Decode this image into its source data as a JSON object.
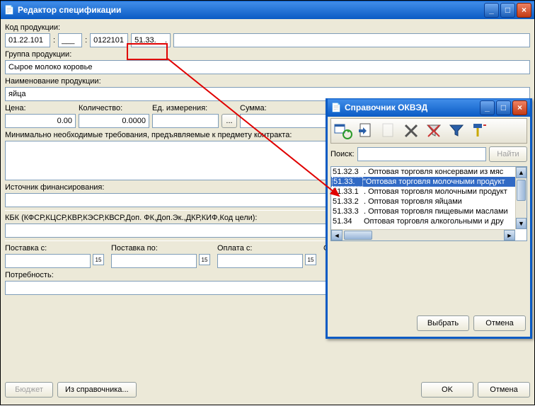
{
  "main": {
    "title": "Редактор спецификации",
    "labels": {
      "product_code": "Код продукции:",
      "product_group": "Группа продукции:",
      "product_name": "Наименование продукции:",
      "price": "Цена:",
      "quantity": "Количество:",
      "unit": "Ед. измерения:",
      "sum": "Сумма:",
      "min_req": "Минимально необходимые требования, предъявляемые к предмету контракта:",
      "fin_source": "Источник финансирования:",
      "kbk": "КБК (КФСР,КЦСР,КВР,КЭСР,КВСР,Доп. ФК,Доп.Эк.,ДКР,КИФ,Код цели):",
      "supply_from": "Поставка с:",
      "supply_to": "Поставка по:",
      "pay_from": "Оплата с:",
      "pay_to": "О",
      "need": "Потребность:"
    },
    "values": {
      "code_seg1": "01.22.101",
      "code_seg2": "___",
      "code_seg3": "0122101",
      "code_seg4": "51.33.__.",
      "group": "Сырое молоко коровье",
      "name": "яйца",
      "price": "0.00",
      "quantity": "0.0000",
      "unit": "",
      "sum": "0.00",
      "min_req": "",
      "fin_source": "",
      "kbk": "",
      "supply_from": "",
      "supply_to": "",
      "pay_from": "",
      "need": ""
    },
    "buttons": {
      "budget": "Бюджет",
      "from_ref": "Из справочника...",
      "ok": "OK",
      "cancel": "Отмена",
      "date_cell": "15",
      "dots": "..."
    }
  },
  "okved": {
    "title": "Справочник ОКВЭД",
    "search_label": "Поиск:",
    "find_btn": "Найти",
    "select_btn": "Выбрать",
    "cancel_btn": "Отмена",
    "items": [
      {
        "code": "51.32.3",
        "text": ". Оптовая торговля консервами из мяс"
      },
      {
        "code": "51.33.",
        "text": "\"Оптовая торговля молочными продукт",
        "selected": true
      },
      {
        "code": "51.33.1",
        "text": ". Оптовая торговля молочными продукт"
      },
      {
        "code": "51.33.2",
        "text": ". Оптовая торговля яйцами"
      },
      {
        "code": "51.33.3",
        "text": ". Оптовая торговля пищевыми маслами"
      },
      {
        "code": "51.34",
        "text": "   Оптовая торговля алкогольными и дру"
      }
    ]
  }
}
